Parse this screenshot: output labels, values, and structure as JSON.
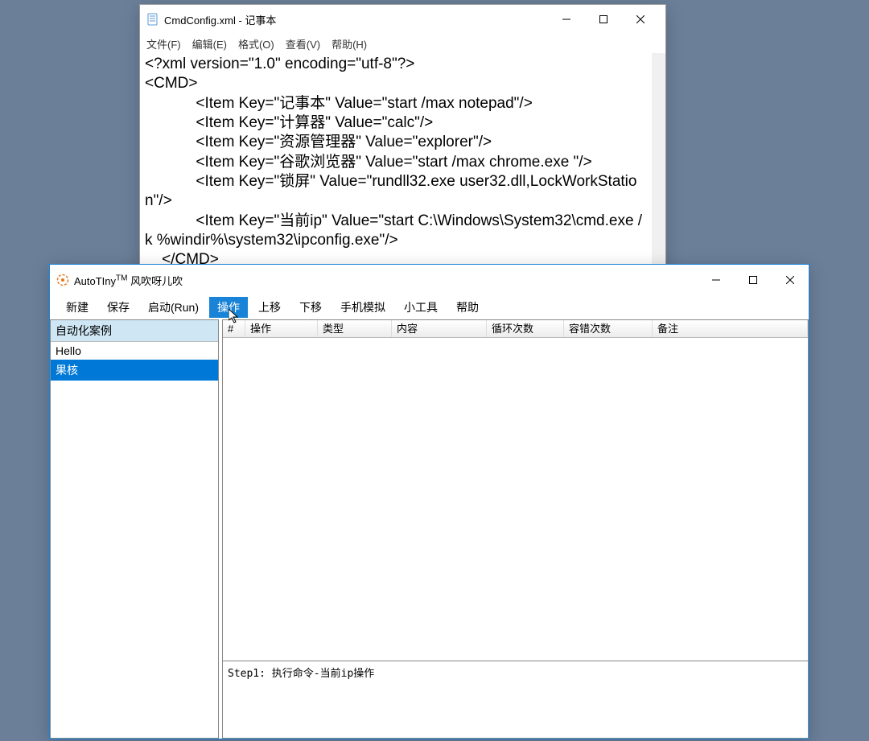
{
  "notepad": {
    "title": "CmdConfig.xml - 记事本",
    "menu": [
      "文件(F)",
      "编辑(E)",
      "格式(O)",
      "查看(V)",
      "帮助(H)"
    ],
    "content": "<?xml version=\"1.0\" encoding=\"utf-8\"?>\n<CMD>\n            <Item Key=\"记事本\" Value=\"start /max notepad\"/>\n            <Item Key=\"计算器\" Value=\"calc\"/>\n            <Item Key=\"资源管理器\" Value=\"explorer\"/>\n            <Item Key=\"谷歌浏览器\" Value=\"start /max chrome.exe \"/>\n            <Item Key=\"锁屏\" Value=\"rundll32.exe user32.dll,LockWorkStation\"/>\n            <Item Key=\"当前ip\" Value=\"start C:\\Windows\\System32\\cmd.exe /k %windir%\\system32\\ipconfig.exe\"/>\n    </CMD>"
  },
  "autotiny": {
    "title_app": "AutoTIny",
    "title_tm": "TM",
    "title_sub": " 风吹呀儿吹",
    "toolbar": [
      "新建",
      "保存",
      "启动(Run)",
      "操作",
      "上移",
      "下移",
      "手机模拟",
      "小工具",
      "帮助"
    ],
    "activeToolbarIndex": 3,
    "left_header": "自动化案例",
    "left_items": [
      "Hello",
      "果核"
    ],
    "selectedLeftIndex": 1,
    "columns": [
      "#",
      "操作",
      "类型",
      "内容",
      "循环次数",
      "容错次数",
      "备注"
    ],
    "log": "Step1: 执行命令-当前ip操作"
  }
}
